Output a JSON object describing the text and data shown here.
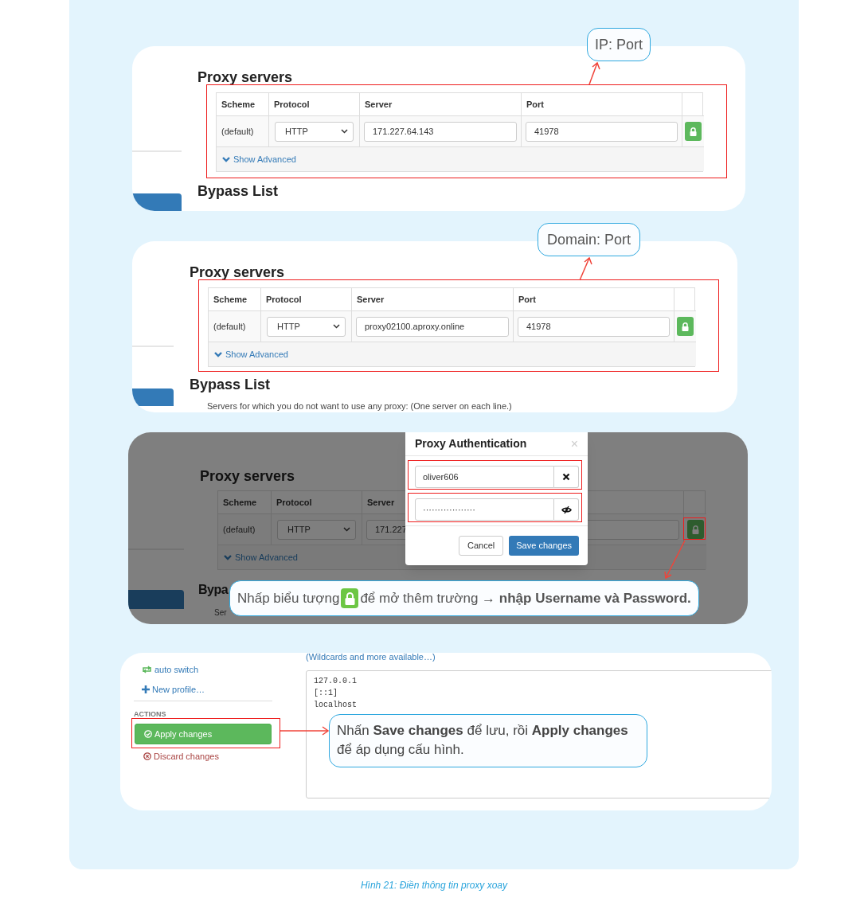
{
  "proxy_panels": [
    {
      "callout": "IP: Port",
      "heading": "Proxy servers",
      "columns": [
        "Scheme",
        "Protocol",
        "Server",
        "Port"
      ],
      "scheme": "(default)",
      "protocol": "HTTP",
      "server": "171.227.64.143",
      "port": "41978",
      "show_advanced": "Show Advanced",
      "bypass_heading": "Bypass List"
    },
    {
      "callout": "Domain: Port",
      "heading": "Proxy servers",
      "columns": [
        "Scheme",
        "Protocol",
        "Server",
        "Port"
      ],
      "scheme": "(default)",
      "protocol": "HTTP",
      "server": "proxy02100.aproxy.online",
      "port": "41978",
      "show_advanced": "Show Advanced",
      "bypass_heading": "Bypass List",
      "bypass_note": "Servers for which you do not want to use any proxy: (One server on each line.)"
    }
  ],
  "auth_panel": {
    "heading": "Proxy servers",
    "columns": [
      "Scheme",
      "Protocol",
      "Server"
    ],
    "scheme": "(default)",
    "protocol": "HTTP",
    "server": "171.227",
    "show_advanced": "Show Advanced",
    "bypass_heading": "Bypa",
    "bypass_note": "Ser",
    "dialog": {
      "title": "Proxy Authentication",
      "close": "×",
      "username": "oliver606",
      "password": "··················",
      "cancel": "Cancel",
      "save": "Save changes"
    },
    "callout_before": "Nhấp biểu tượng",
    "callout_after": "để mở thêm trường → **nhập Username và Password.**"
  },
  "actions_panel": {
    "sidebar": [
      {
        "kind": "switch",
        "label": "auto switch"
      },
      {
        "kind": "new",
        "label": "New profile…"
      }
    ],
    "section": "ACTIONS",
    "apply": "Apply changes",
    "discard": "Discard changes",
    "wildcards_link": "(Wildcards and more available…)",
    "bypass_lines": [
      "127.0.0.1",
      "[::1]",
      "localhost"
    ],
    "callout": "Nhấn **Save changes** để lưu, rồi **Apply changes** để áp dụng cấu hình."
  },
  "caption": "Hình 21: Điền thông tin proxy xoay"
}
